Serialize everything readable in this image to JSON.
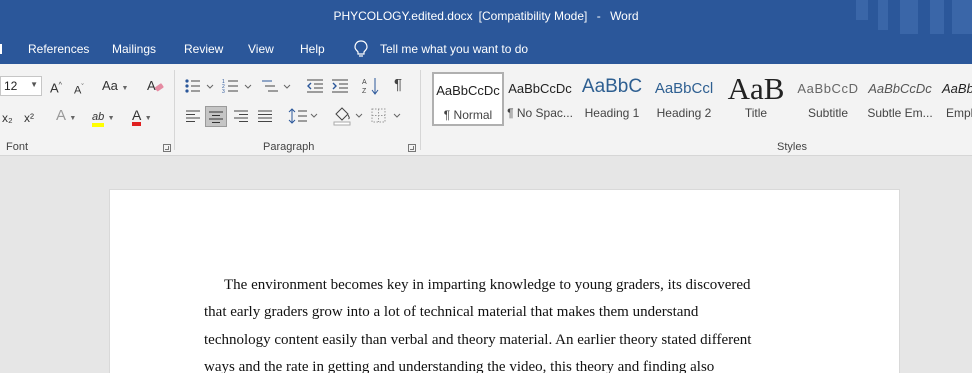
{
  "titlebar": {
    "doc_name": "PHYCOLOGY.edited.docx",
    "mode": "[Compatibility Mode]",
    "dash": "-",
    "app": "Word"
  },
  "menu": {
    "items": [
      "References",
      "Mailings",
      "Review",
      "View",
      "Help"
    ],
    "tell_me": "Tell me what you want to do"
  },
  "font_group": {
    "size": "12",
    "grow_label": "A",
    "shrink_label": "A",
    "case_label": "Aa",
    "subscript": "x₂",
    "superscript": "x²",
    "effects_label": "A",
    "highlight_label": "ab",
    "font_color_label": "A",
    "label": "Font"
  },
  "paragraph_group": {
    "label": "Paragraph",
    "show_marks": "¶"
  },
  "styles_group": {
    "label": "Styles",
    "items": [
      {
        "preview": "AaBbCcDc",
        "name": "¶ Normal"
      },
      {
        "preview": "AaBbCcDc",
        "name": "¶ No Spac..."
      },
      {
        "preview": "AaBbC",
        "name": "Heading 1"
      },
      {
        "preview": "AaBbCcl",
        "name": "Heading 2"
      },
      {
        "preview": "AaB",
        "name": "Title"
      },
      {
        "preview": "AaBbCcD",
        "name": "Subtitle"
      },
      {
        "preview": "AaBbCcDc",
        "name": "Subtle Em..."
      },
      {
        "preview": "AaBb",
        "name": "Empl"
      }
    ]
  },
  "document": {
    "lines": [
      "The environment becomes key in imparting knowledge to young graders, its discovered",
      "that early graders grow into a lot of technical material that makes them understand",
      "technology content easily than verbal and theory material. An earlier theory stated different",
      "ways and the rate in getting and understanding the video, this theory and finding also"
    ]
  },
  "colors": {
    "accent": "#2b579a",
    "highlight": "#ffff00",
    "font_color": "#e02020",
    "heading": "#2e5f91"
  }
}
